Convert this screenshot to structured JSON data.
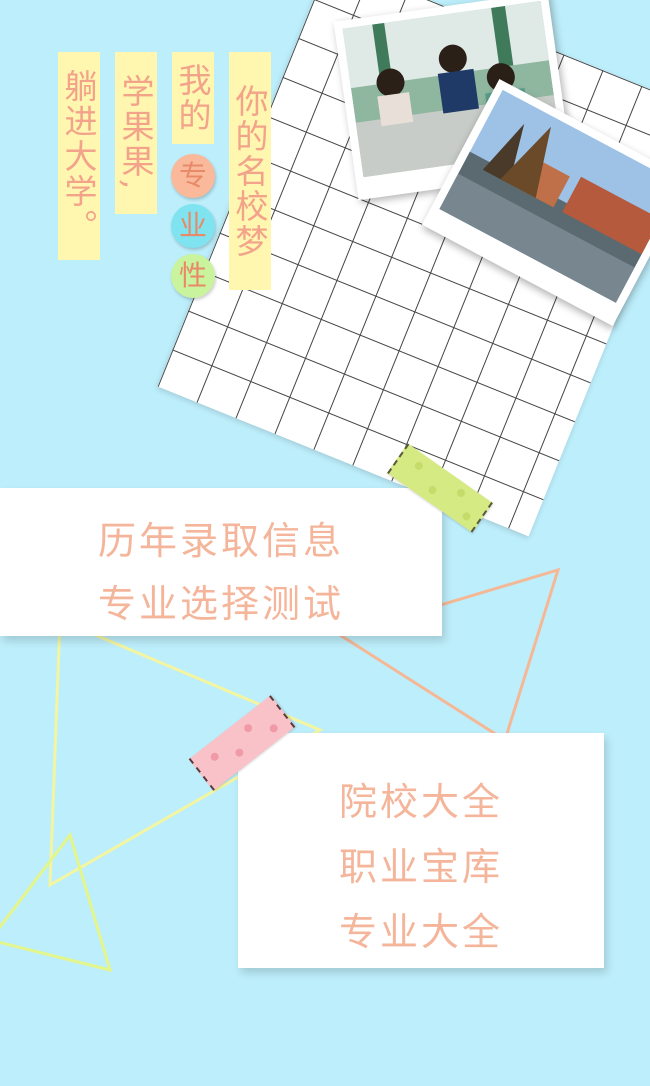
{
  "headline": {
    "col1": "你的名校梦",
    "col2": "我的",
    "col2_badges": [
      "专",
      "业",
      "性"
    ],
    "col3": "学果果,",
    "col4": "躺进大学。"
  },
  "card_top": {
    "line1": "历年录取信息",
    "line2": "专业选择测试"
  },
  "card_bottom": {
    "line1": "院校大全",
    "line2": "职业宝库",
    "line3": "专业大全"
  },
  "colors": {
    "background": "#bdeefb",
    "text_accent": "#f4b59a",
    "column_bg": "#fff6b0",
    "badge_orange": "#f9b99a",
    "badge_cyan": "#7fe3f0",
    "badge_green": "#c9f39c"
  }
}
